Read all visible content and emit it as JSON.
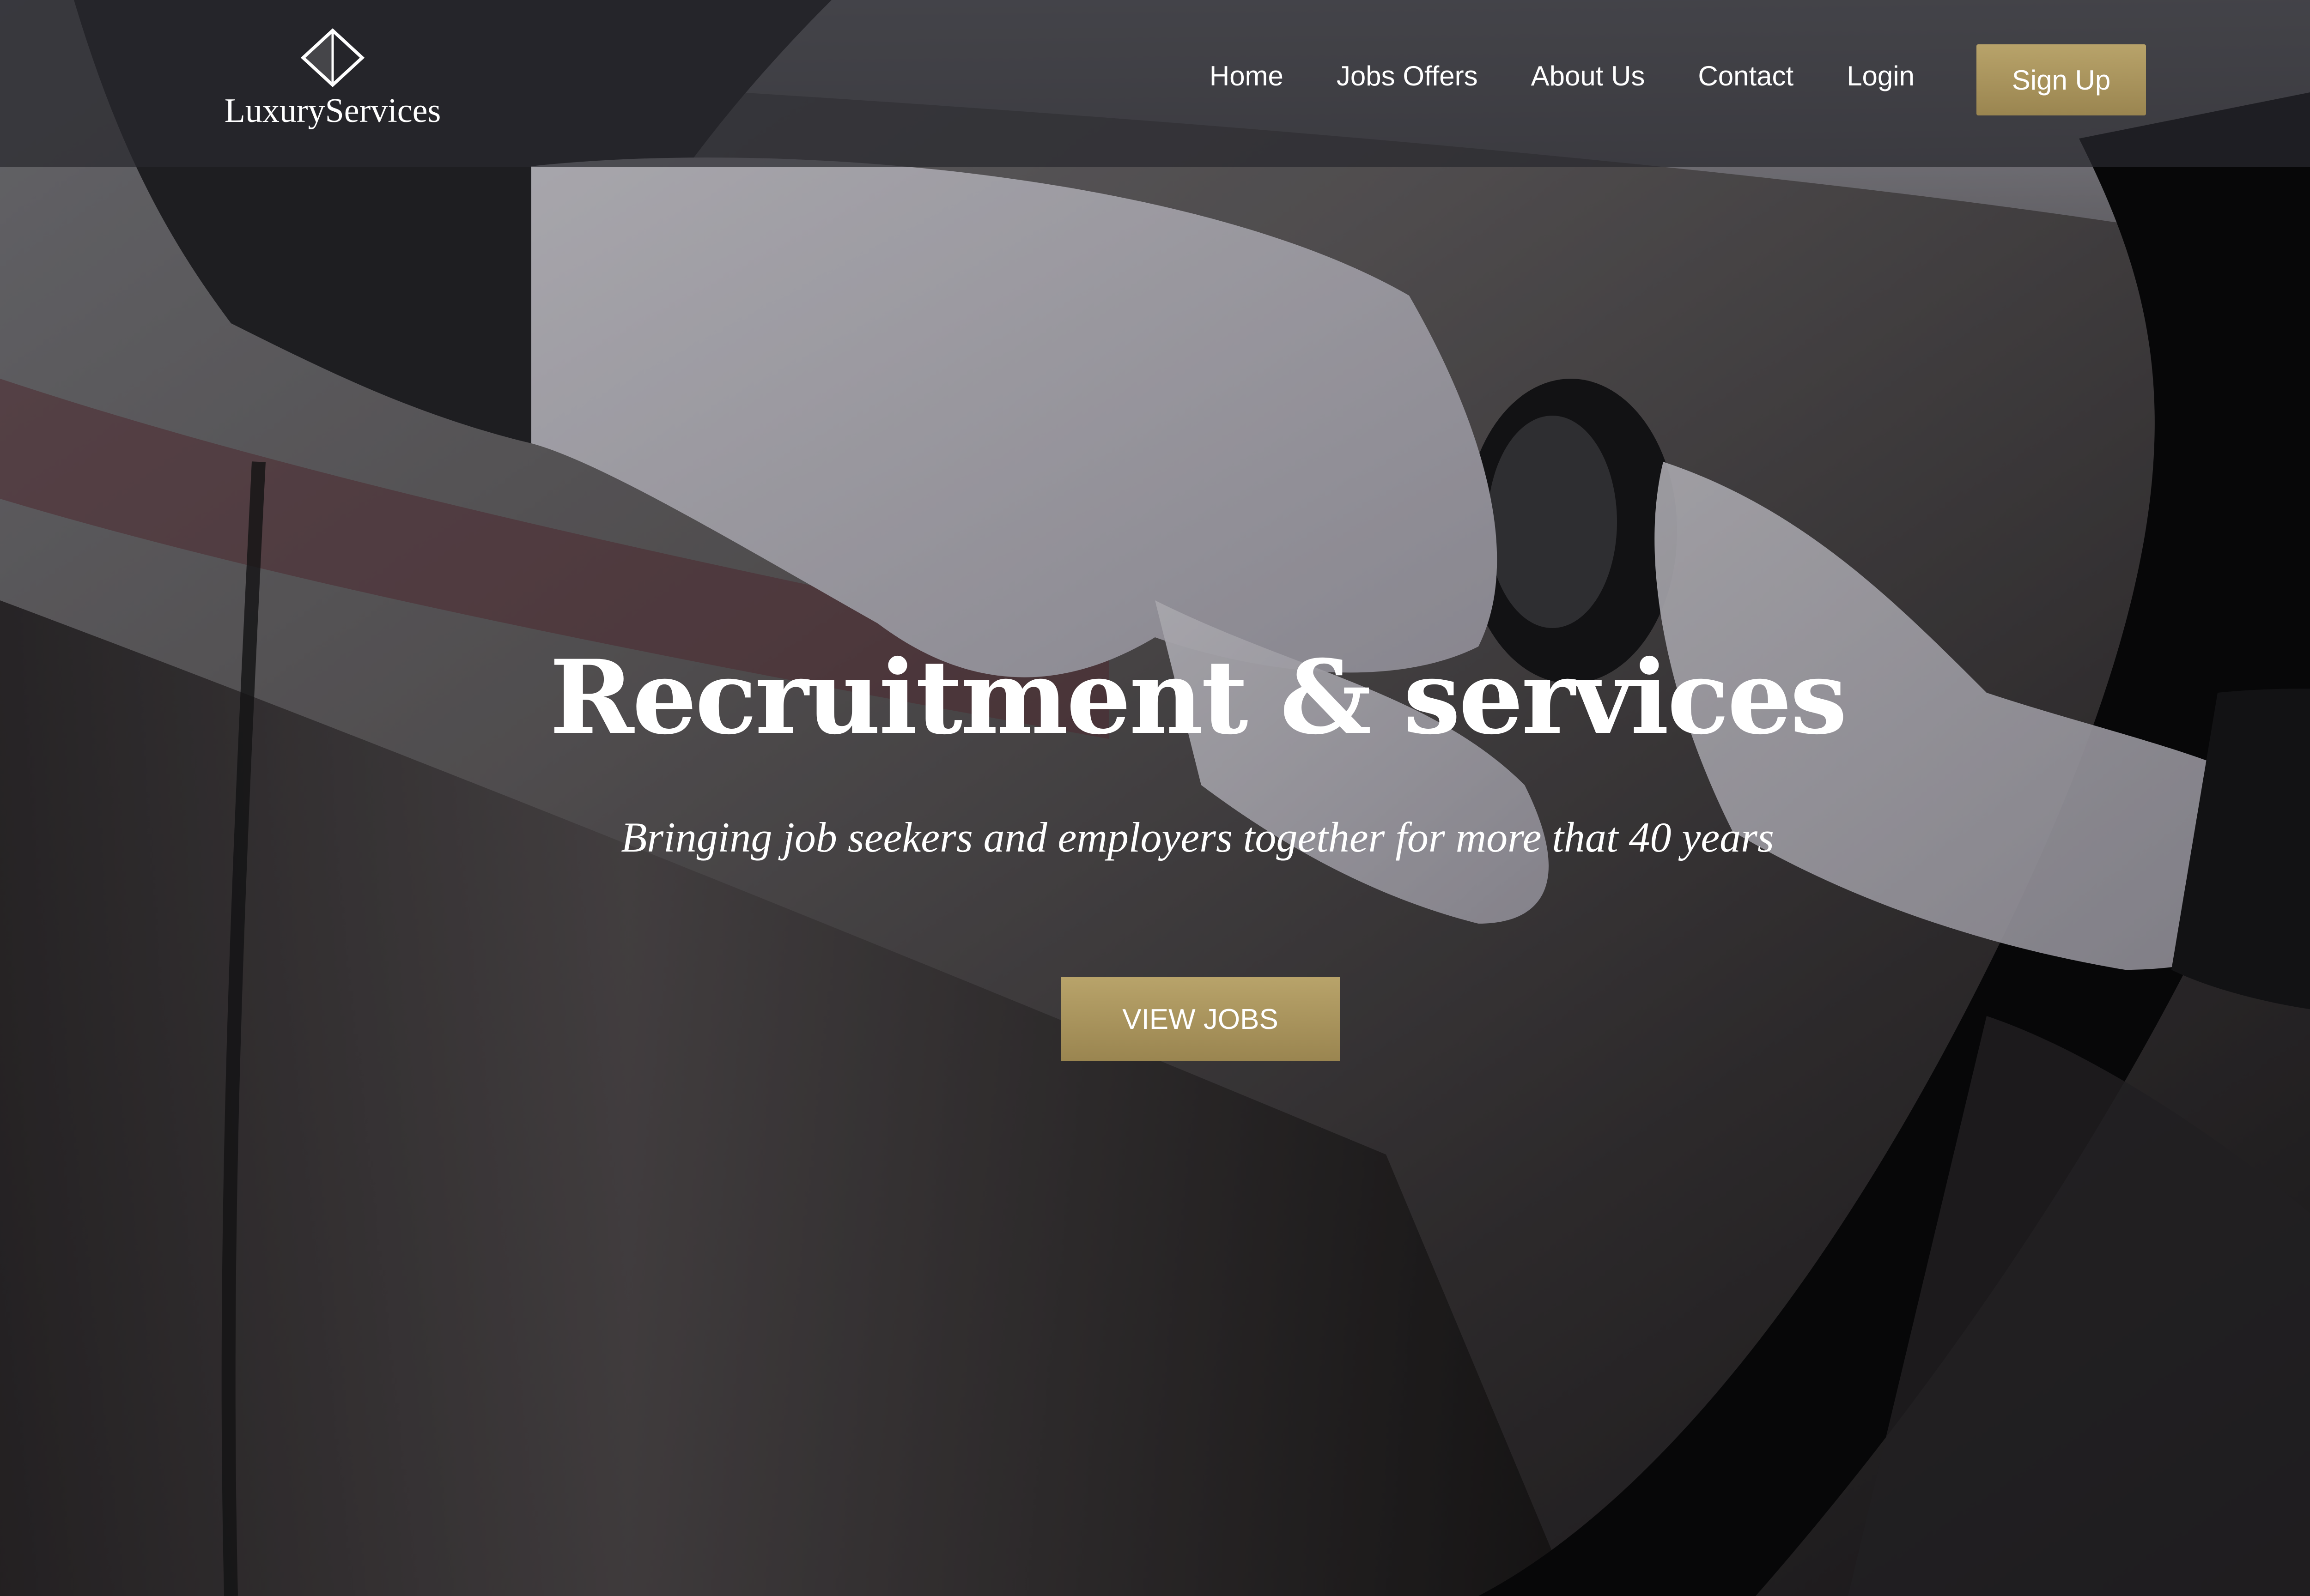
{
  "brand": {
    "name": "LuxuryServices",
    "logo_icon": "diamond-outline-icon"
  },
  "nav": {
    "items": [
      {
        "label": "Home"
      },
      {
        "label": "Jobs Offers"
      },
      {
        "label": "About Us"
      },
      {
        "label": "Contact"
      },
      {
        "label": "Login"
      }
    ],
    "signup_label": "Sign Up"
  },
  "hero": {
    "title": "Recruitment & services",
    "subtitle": "Bringing job seekers and employers together for more that 40 years",
    "cta_label": "VIEW JOBS",
    "image_subject": "white-gloved hand opening a black car door"
  },
  "colors": {
    "accent_gold": "#a8935a",
    "navbar_bg": "#28282e",
    "text": "#ffffff"
  }
}
